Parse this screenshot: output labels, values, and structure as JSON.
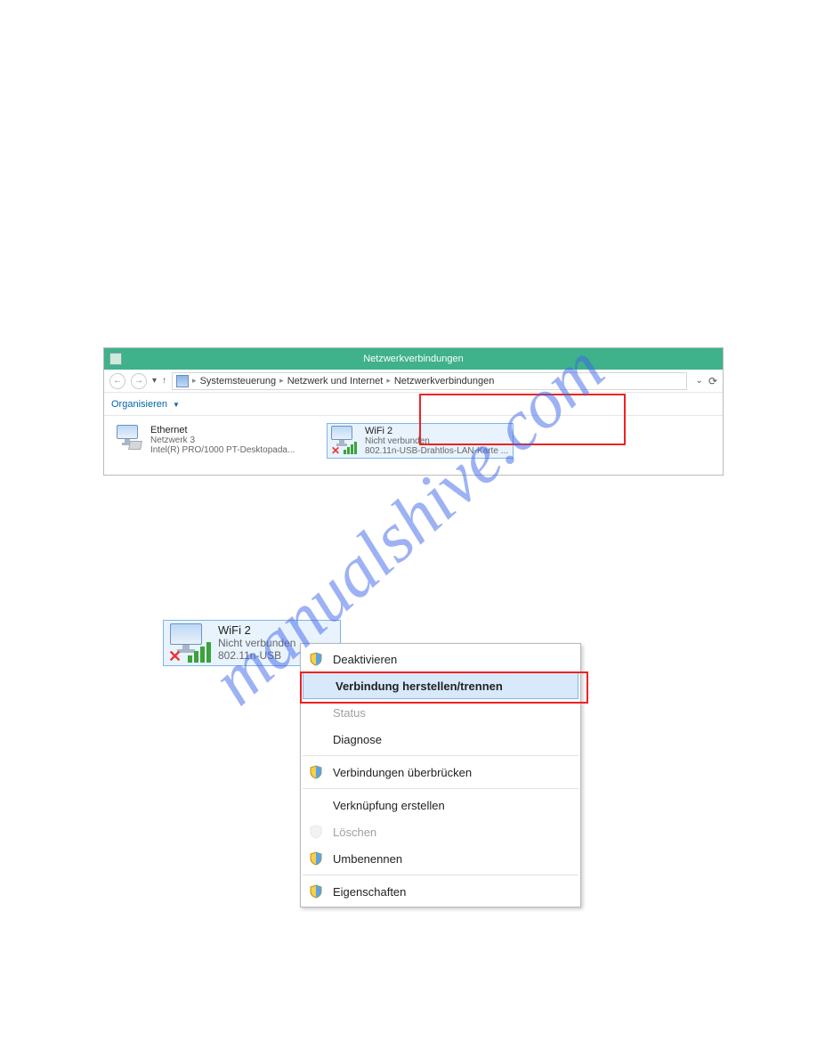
{
  "watermark": "manualshive.com",
  "window": {
    "title": "Netzwerkverbindungen",
    "breadcrumb": {
      "a": "Systemsteuerung",
      "b": "Netzwerk und Internet",
      "c": "Netzwerkverbindungen"
    },
    "toolbar": {
      "organize": "Organisieren"
    }
  },
  "connections": {
    "ethernet": {
      "title": "Ethernet",
      "status": "Netzwerk 3",
      "device": "Intel(R) PRO/1000 PT-Desktopada..."
    },
    "wifi": {
      "title": "WiFi 2",
      "status": "Nicht verbunden",
      "device": "802.11n-USB-Drahtlos-LAN-Karte ..."
    }
  },
  "popup": {
    "title": "WiFi 2",
    "status": "Nicht verbunden",
    "device": "802.11n-USB"
  },
  "menu": {
    "deactivate": "Deaktivieren",
    "connect": "Verbindung herstellen/trennen",
    "status": "Status",
    "diagnose": "Diagnose",
    "bridge": "Verbindungen überbrücken",
    "shortcut": "Verknüpfung erstellen",
    "delete": "Löschen",
    "rename": "Umbenennen",
    "properties": "Eigenschaften"
  }
}
